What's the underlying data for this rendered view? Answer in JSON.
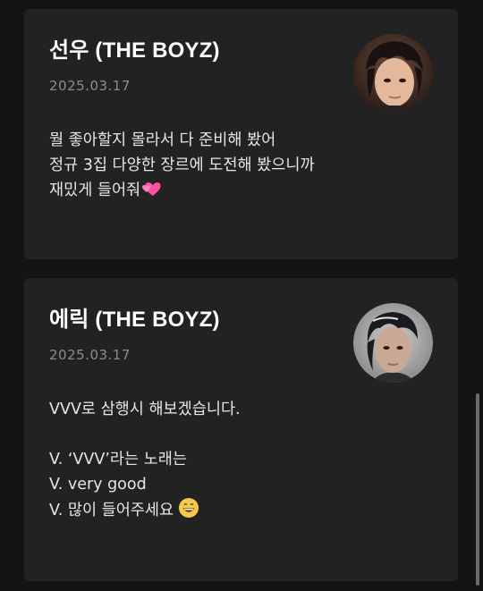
{
  "posts": [
    {
      "author": "선우 (THE BOYZ)",
      "date": "2025.03.17",
      "avatar_icon": "profile-photo",
      "lines": [
        "뭘 좋아할지 몰라서 다 준비해 봤어",
        "정규 3집 다양한 장르에 도전해 봤으니까",
        "재밌게 들어줘"
      ],
      "emoji": "two-hearts-icon"
    },
    {
      "author": "에릭 (THE BOYZ)",
      "date": "2025.03.17",
      "avatar_icon": "profile-photo",
      "lines": [
        "VVV로 삼행시 해보겠습니다.",
        "",
        "V. ‘VVV’라는 노래는",
        "V. very good",
        "V. 많이 들어주세요"
      ],
      "emoji": "grinning-face-icon"
    }
  ],
  "colors": {
    "background": "#141414",
    "card": "#222222",
    "date": "#8c8c8c",
    "text": "#e6e6e6",
    "scrollbar": "#6a6a6a"
  }
}
